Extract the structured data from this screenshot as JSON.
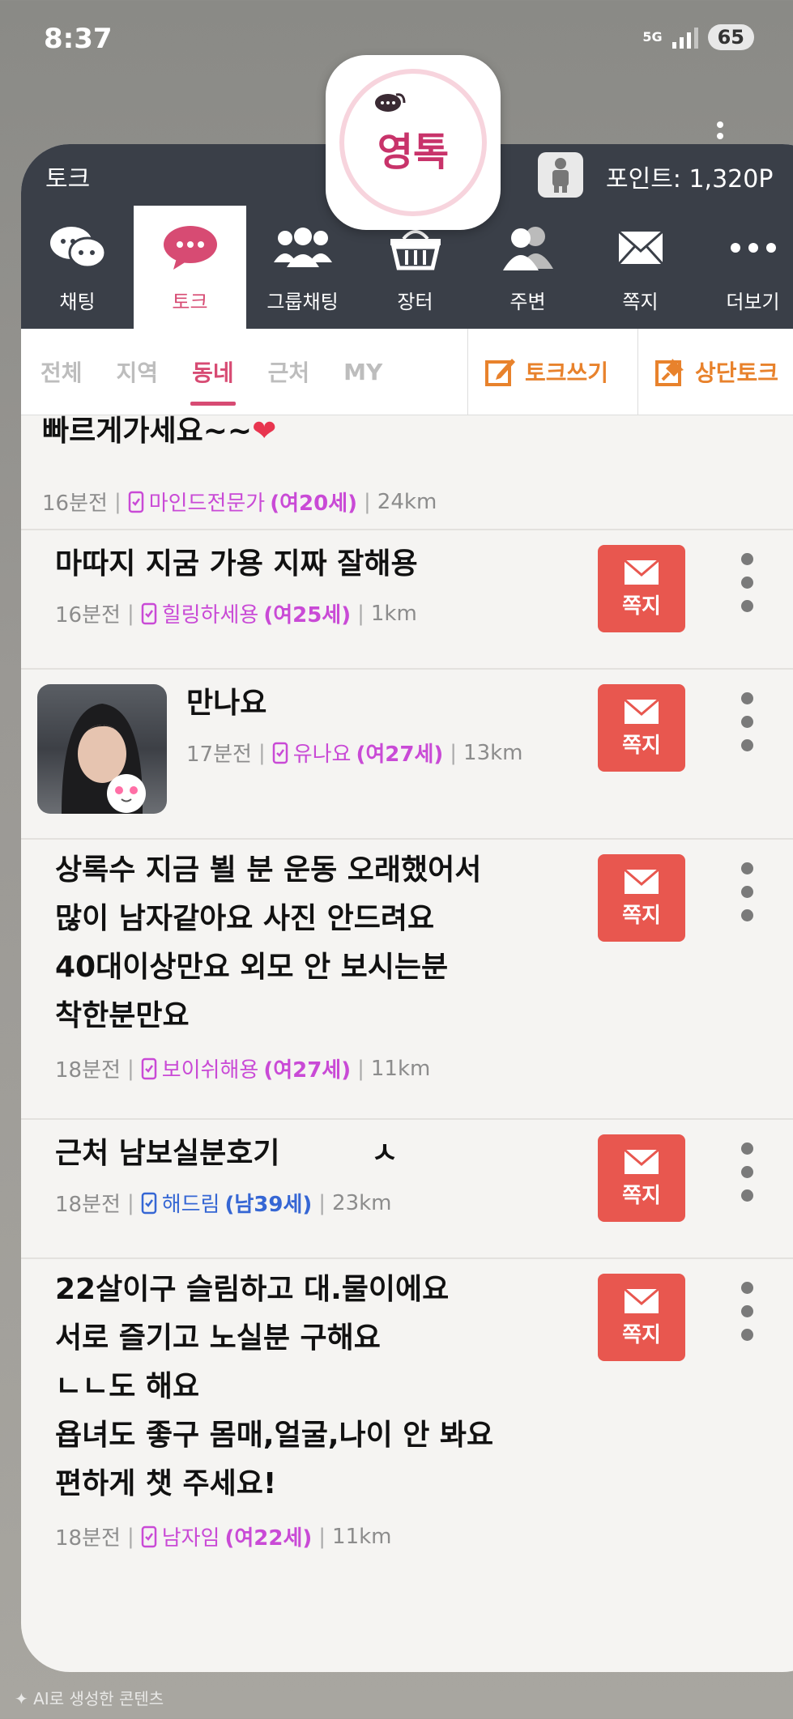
{
  "status_bar": {
    "time": "8:37",
    "network": "5G",
    "battery": "65"
  },
  "app_header": {
    "title": "토크",
    "points": "포인트: 1,320P"
  },
  "logo": {
    "text": "영톡"
  },
  "tabs": [
    {
      "label": "채팅",
      "icon": "chat-bubbles-icon",
      "active": false
    },
    {
      "label": "토크",
      "icon": "speech-dots-icon",
      "active": true
    },
    {
      "label": "그룹채팅",
      "icon": "group-icon",
      "active": false
    },
    {
      "label": "장터",
      "icon": "basket-icon",
      "active": false
    },
    {
      "label": "주변",
      "icon": "people-icon",
      "active": false
    },
    {
      "label": "쪽지",
      "icon": "envelope-icon",
      "active": false
    },
    {
      "label": "더보기",
      "icon": "more-icon",
      "active": false
    }
  ],
  "subtabs": [
    "전체",
    "지역",
    "동네",
    "근처",
    "MY"
  ],
  "subtab_active": "동네",
  "actions": {
    "write": "토크쓰기",
    "top": "상단토크"
  },
  "message_label": "쪽지",
  "posts": [
    {
      "text": "빠르게가세요~~",
      "time": "16분전",
      "nick": "마인드전문가",
      "age": "(여20세)",
      "dist": "24km",
      "gender": "f"
    },
    {
      "text": "마따지 지굼 가용 지짜 잘해용",
      "time": "16분전",
      "nick": "힐링하세용",
      "age": "(여25세)",
      "dist": "1km",
      "gender": "f"
    },
    {
      "text": "만나요",
      "time": "17분전",
      "nick": "유나요",
      "age": "(여27세)",
      "dist": "13km",
      "gender": "f"
    },
    {
      "text": "상록수 지금 뵐 분 운동 오래했어서\n많이 남자같아요 사진 안드려요\n40대이상만요 외모 안 보시는분\n착한분만요",
      "time": "18분전",
      "nick": "보이쉬해용",
      "age": "(여27세)",
      "dist": "11km",
      "gender": "f"
    },
    {
      "text": "근처 남보실분호기         ㅅ",
      "time": "18분전",
      "nick": "해드림",
      "age": "(남39세)",
      "dist": "23km",
      "gender": "m"
    },
    {
      "text": "22살이구 슬림하고 대.물이에요\n서로 즐기고 노실분 구해요\nㄴㄴ도 해요\n욥녀도 좋구 몸매,얼굴,나이 안 봐요\n편하게 챗 주세요!",
      "time": "18분전",
      "nick": "남자임",
      "age": "(여22세)",
      "dist": "11km",
      "gender": "f"
    }
  ],
  "watermark": "✦ AI로 생성한 콘텐츠",
  "colors": {
    "accent": "#d74b73",
    "header": "#3a3f48",
    "message_button": "#e8574f",
    "female": "#c94ad6",
    "male": "#3566d4",
    "action": "#e8822c"
  }
}
